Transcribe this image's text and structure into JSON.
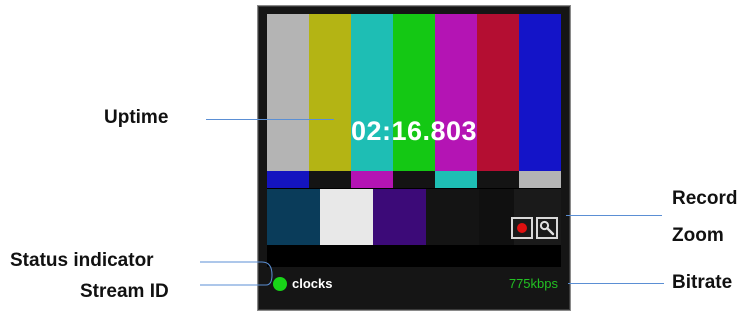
{
  "player": {
    "uptime": "02:16.803",
    "stream_id": "clocks",
    "bitrate": "775kbps",
    "status_color": "#18d418",
    "icons": {
      "record": "record-icon",
      "zoom": "magnifier-icon",
      "status": "status-dot-icon"
    },
    "color_bars": [
      "#b4b4b4",
      "#b4b414",
      "#1ebeb4",
      "#14c814",
      "#b414b4",
      "#b40e32",
      "#1414c8"
    ],
    "mid_bars": [
      "#1414c0",
      "#141414",
      "#b414b4",
      "#141414",
      "#1ebeb4",
      "#141414",
      "#b4b4b4"
    ],
    "bottom_blocks": [
      "#0a3c5a",
      "#e8e8e8",
      "#3c0a78",
      "#141414",
      "#101010",
      "#1a1a1a"
    ]
  },
  "callouts": {
    "uptime": "Uptime",
    "record": "Record",
    "zoom": "Zoom",
    "status_indicator": "Status indicator",
    "stream_id": "Stream ID",
    "bitrate": "Bitrate"
  }
}
